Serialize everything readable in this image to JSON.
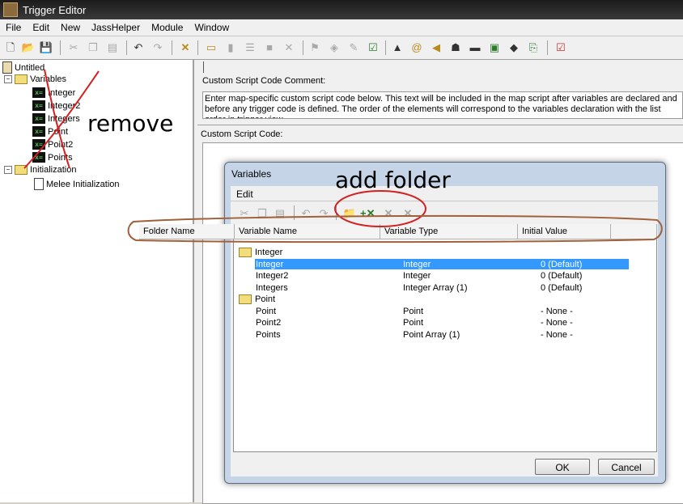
{
  "window": {
    "title": "Trigger Editor"
  },
  "menu": [
    "File",
    "Edit",
    "New",
    "JassHelper",
    "Module",
    "Window"
  ],
  "tree": {
    "root": "Untitled",
    "nodes": [
      {
        "label": "Variables",
        "kind": "folder"
      },
      {
        "label": "Integer",
        "kind": "var"
      },
      {
        "label": "Integer2",
        "kind": "var"
      },
      {
        "label": "Integers",
        "kind": "var"
      },
      {
        "label": "Point",
        "kind": "var"
      },
      {
        "label": "Point2",
        "kind": "var"
      },
      {
        "label": "Points",
        "kind": "var"
      },
      {
        "label": "Initialization",
        "kind": "folder"
      },
      {
        "label": "Melee Initialization",
        "kind": "doc"
      }
    ]
  },
  "panel": {
    "comment_label": "Custom Script Code Comment:",
    "comment_text": "Enter map-specific custom script code below.  This text will be included in the map script after variables are declared and before any trigger code is defined. The order of the elements will correspond to the variables declaration with the list order in trigger view.",
    "code_label": "Custom Script Code:"
  },
  "dialog": {
    "title": "Variables",
    "menu_edit": "Edit",
    "columns": [
      "Folder Name",
      "Variable Name",
      "Variable Type",
      "Initial Value"
    ],
    "rows": [
      {
        "type": "folder",
        "name": "Integer"
      },
      {
        "type": "var",
        "name": "Integer",
        "vtype": "Integer",
        "init": "0 (Default)",
        "selected": true
      },
      {
        "type": "var",
        "name": "Integer2",
        "vtype": "Integer",
        "init": "0 (Default)"
      },
      {
        "type": "var",
        "name": "Integers",
        "vtype": "Integer Array (1)",
        "init": "0 (Default)"
      },
      {
        "type": "folder",
        "name": "Point"
      },
      {
        "type": "var",
        "name": "Point",
        "vtype": "Point",
        "init": "- None -"
      },
      {
        "type": "var",
        "name": "Point2",
        "vtype": "Point",
        "init": "- None -"
      },
      {
        "type": "var",
        "name": "Points",
        "vtype": "Point Array (1)",
        "init": "- None -"
      }
    ],
    "ok_label": "OK",
    "cancel_label": "Cancel"
  },
  "annotations": {
    "remove": "remove",
    "add_folder": "add folder"
  },
  "colors": {
    "annotation_red": "#d42020",
    "annotation_brown": "#a0603a",
    "selection": "#3399ff"
  }
}
